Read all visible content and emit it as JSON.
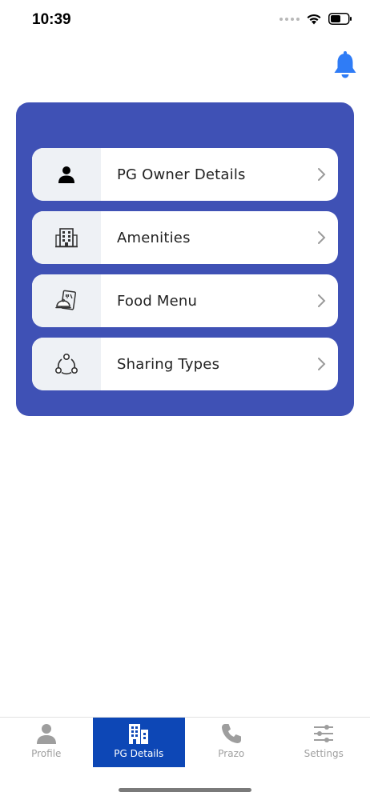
{
  "status_bar": {
    "time": "10:39"
  },
  "colors": {
    "accent": "#3f51b5",
    "bell": "#2f7cf6",
    "tab_active": "#0d47b6",
    "tab_inactive": "#a0a0a0"
  },
  "menu": [
    {
      "label": "PG Owner Details",
      "icon": "person-icon"
    },
    {
      "label": "Amenities",
      "icon": "building-icon"
    },
    {
      "label": "Food Menu",
      "icon": "food-menu-icon"
    },
    {
      "label": "Sharing Types",
      "icon": "sharing-icon"
    }
  ],
  "tabs": [
    {
      "label": "Profile",
      "icon": "person-icon",
      "active": false
    },
    {
      "label": "PG Details",
      "icon": "building-icon",
      "active": true
    },
    {
      "label": "Prazo",
      "icon": "phone-icon",
      "active": false
    },
    {
      "label": "Settings",
      "icon": "sliders-icon",
      "active": false
    }
  ]
}
